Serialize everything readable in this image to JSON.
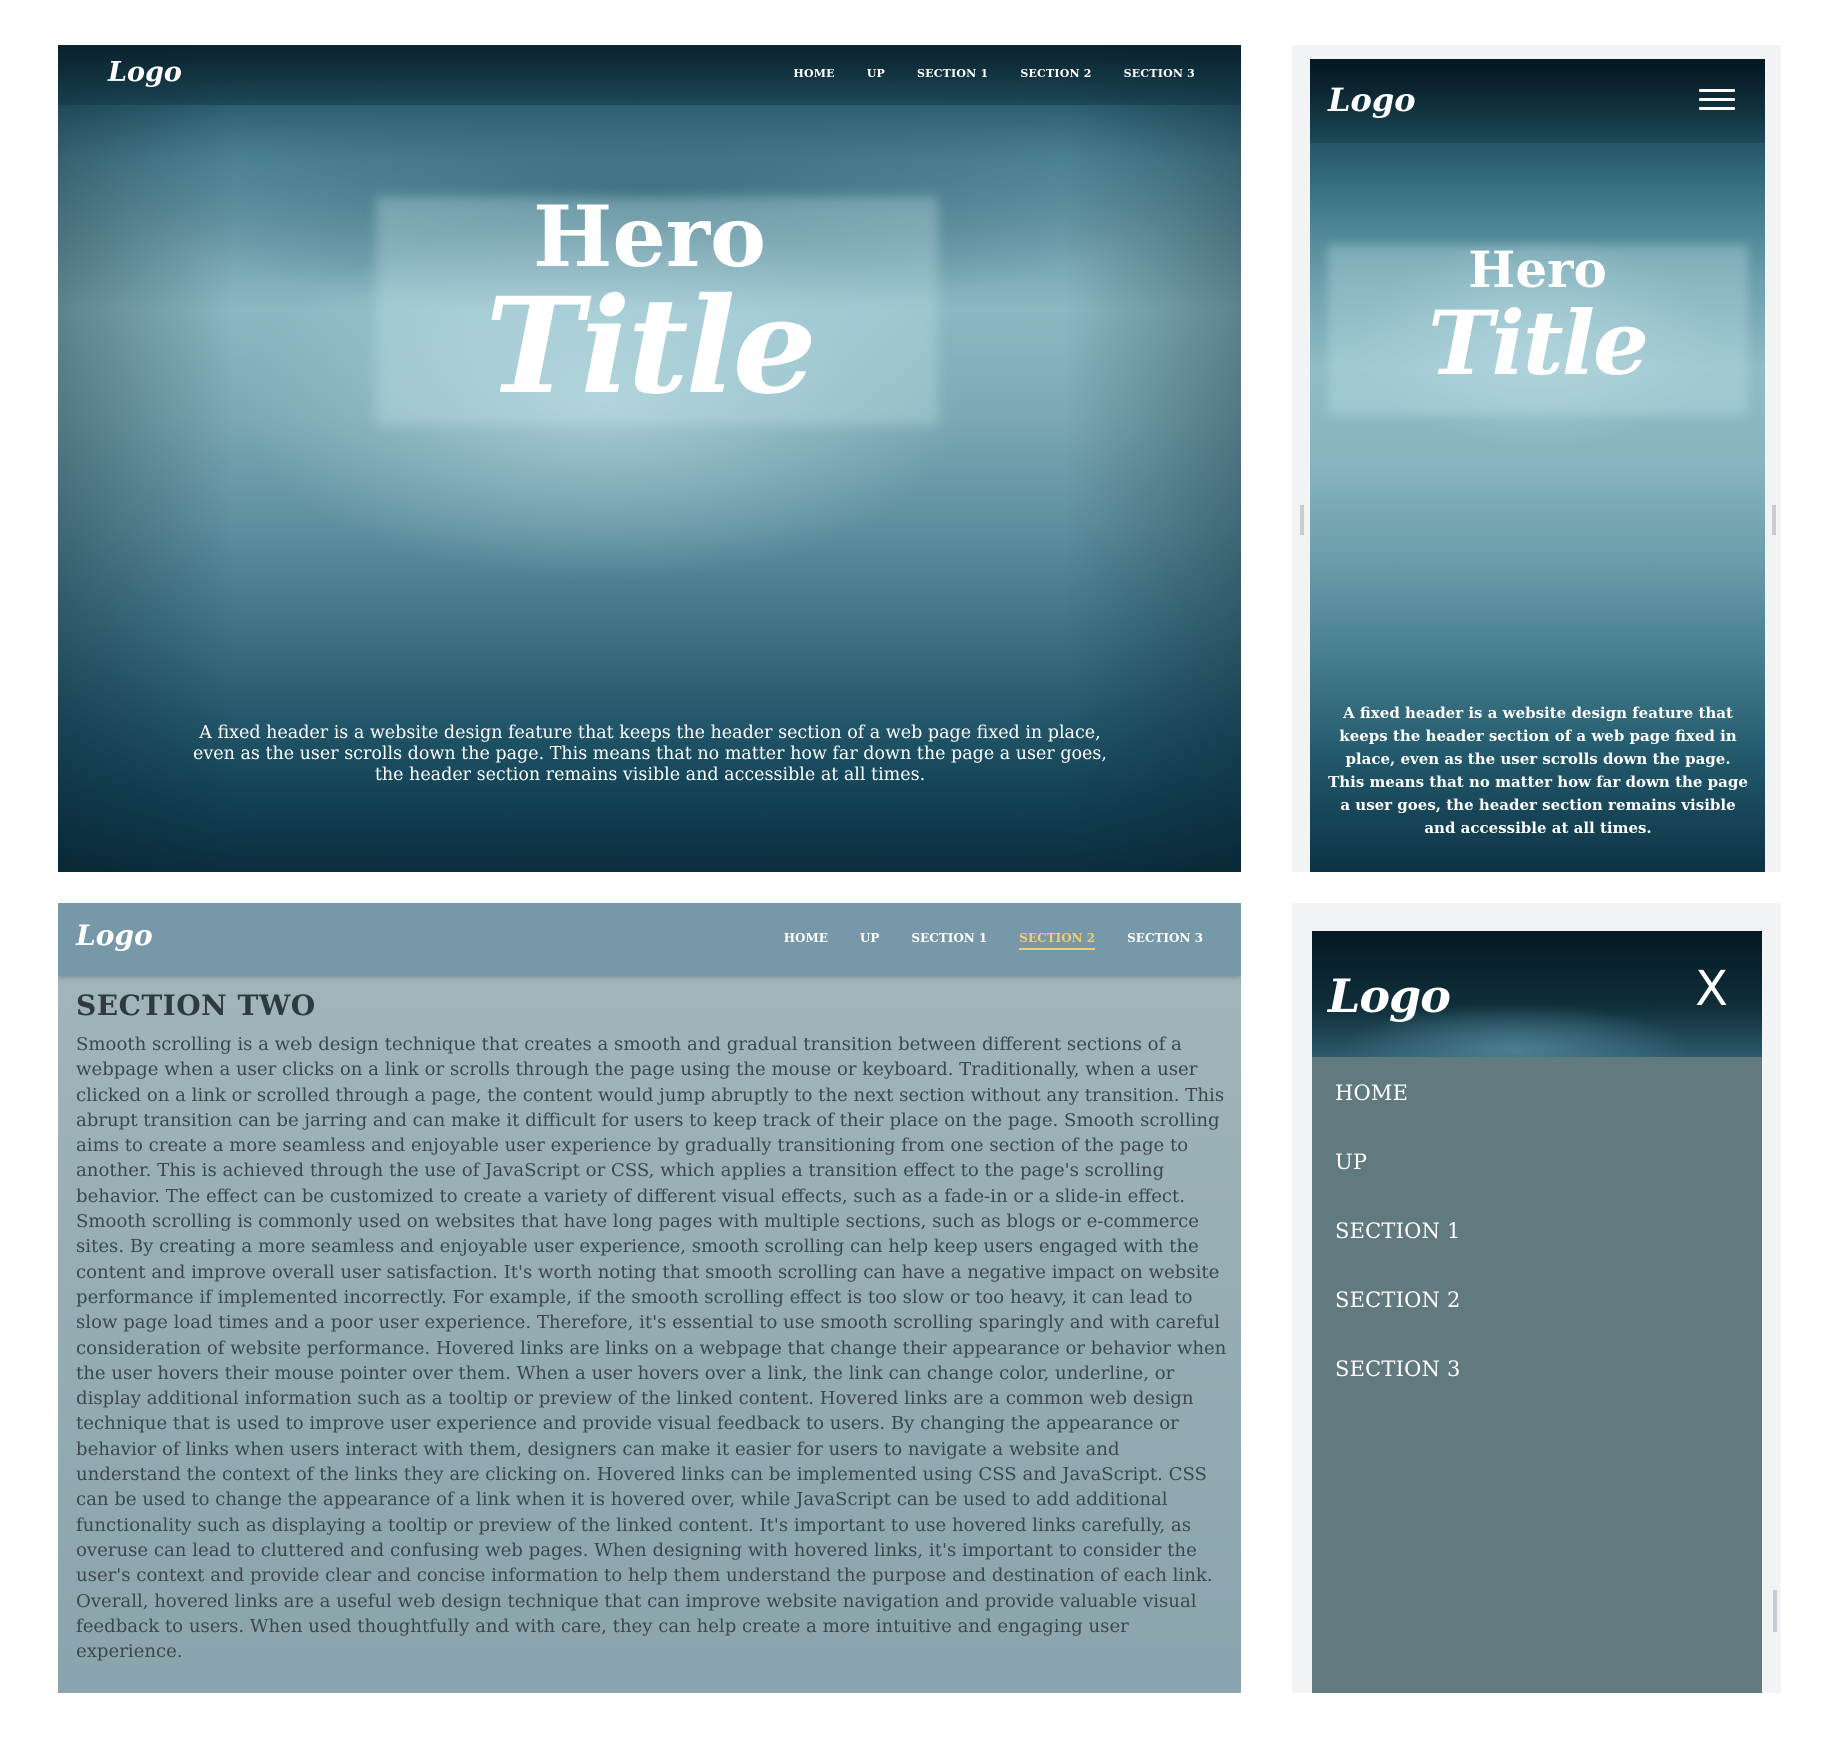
{
  "desktop_hero": {
    "logo": "Logo",
    "nav": [
      "HOME",
      "UP",
      "SECTION 1",
      "SECTION 2",
      "SECTION 3"
    ],
    "hero_line1": "Hero",
    "hero_line2": "Title",
    "description": "A fixed header is a website design feature that keeps the header section of a web page fixed in place, even as the user scrolls down the page. This means that no matter how far down the page a user goes, the header section remains visible and accessible at all times."
  },
  "mobile_hero": {
    "logo": "Logo",
    "hero_line1": "Hero",
    "hero_line2": "Title",
    "description": "A fixed header is a website design feature that keeps the header section of a web page fixed in place, even as the user scrolls down the page. This means that no matter how far down the page a user goes, the header section remains visible and accessible at all times."
  },
  "section_page": {
    "logo": "Logo",
    "nav": [
      "HOME",
      "UP",
      "SECTION 1",
      "SECTION 2",
      "SECTION 3"
    ],
    "active_nav": "SECTION 2",
    "active_color": "#f3cd73",
    "heading": "SECTION TWO",
    "body": "Smooth scrolling is a web design technique that creates a smooth and gradual transition between different sections of a webpage when a user clicks on a link or scrolls through the page using the mouse or keyboard. Traditionally, when a user clicked on a link or scrolled through a page, the content would jump abruptly to the next section without any transition. This abrupt transition can be jarring and can make it difficult for users to keep track of their place on the page. Smooth scrolling aims to create a more seamless and enjoyable user experience by gradually transitioning from one section of the page to another. This is achieved through the use of JavaScript or CSS, which applies a transition effect to the page's scrolling behavior. The effect can be customized to create a variety of different visual effects, such as a fade-in or a slide-in effect. Smooth scrolling is commonly used on websites that have long pages with multiple sections, such as blogs or e-commerce sites. By creating a more seamless and enjoyable user experience, smooth scrolling can help keep users engaged with the content and improve overall user satisfaction. It's worth noting that smooth scrolling can have a negative impact on website performance if implemented incorrectly. For example, if the smooth scrolling effect is too slow or too heavy, it can lead to slow page load times and a poor user experience. Therefore, it's essential to use smooth scrolling sparingly and with careful consideration of website performance. Hovered links are links on a webpage that change their appearance or behavior when the user hovers their mouse pointer over them. When a user hovers over a link, the link can change color, underline, or display additional information such as a tooltip or preview of the linked content. Hovered links are a common web design technique that is used to improve user experience and provide visual feedback to users. By changing the appearance or behavior of links when users interact with them, designers can make it easier for users to navigate a website and understand the context of the links they are clicking on. Hovered links can be implemented using CSS and JavaScript. CSS can be used to change the appearance of a link when it is hovered over, while JavaScript can be used to add additional functionality such as displaying a tooltip or preview of the linked content. It's important to use hovered links carefully, as overuse can lead to cluttered and confusing web pages. When designing with hovered links, it's important to consider the user's context and provide clear and concise information to help them understand the purpose and destination of each link. Overall, hovered links are a useful web design technique that can improve website navigation and provide valuable visual feedback to users. When used thoughtfully and with care, they can help create a more intuitive and engaging user experience."
  },
  "mobile_menu": {
    "logo": "Logo",
    "close_label": "X",
    "items": [
      "HOME",
      "UP",
      "SECTION 1",
      "SECTION 2",
      "SECTION 3"
    ]
  }
}
